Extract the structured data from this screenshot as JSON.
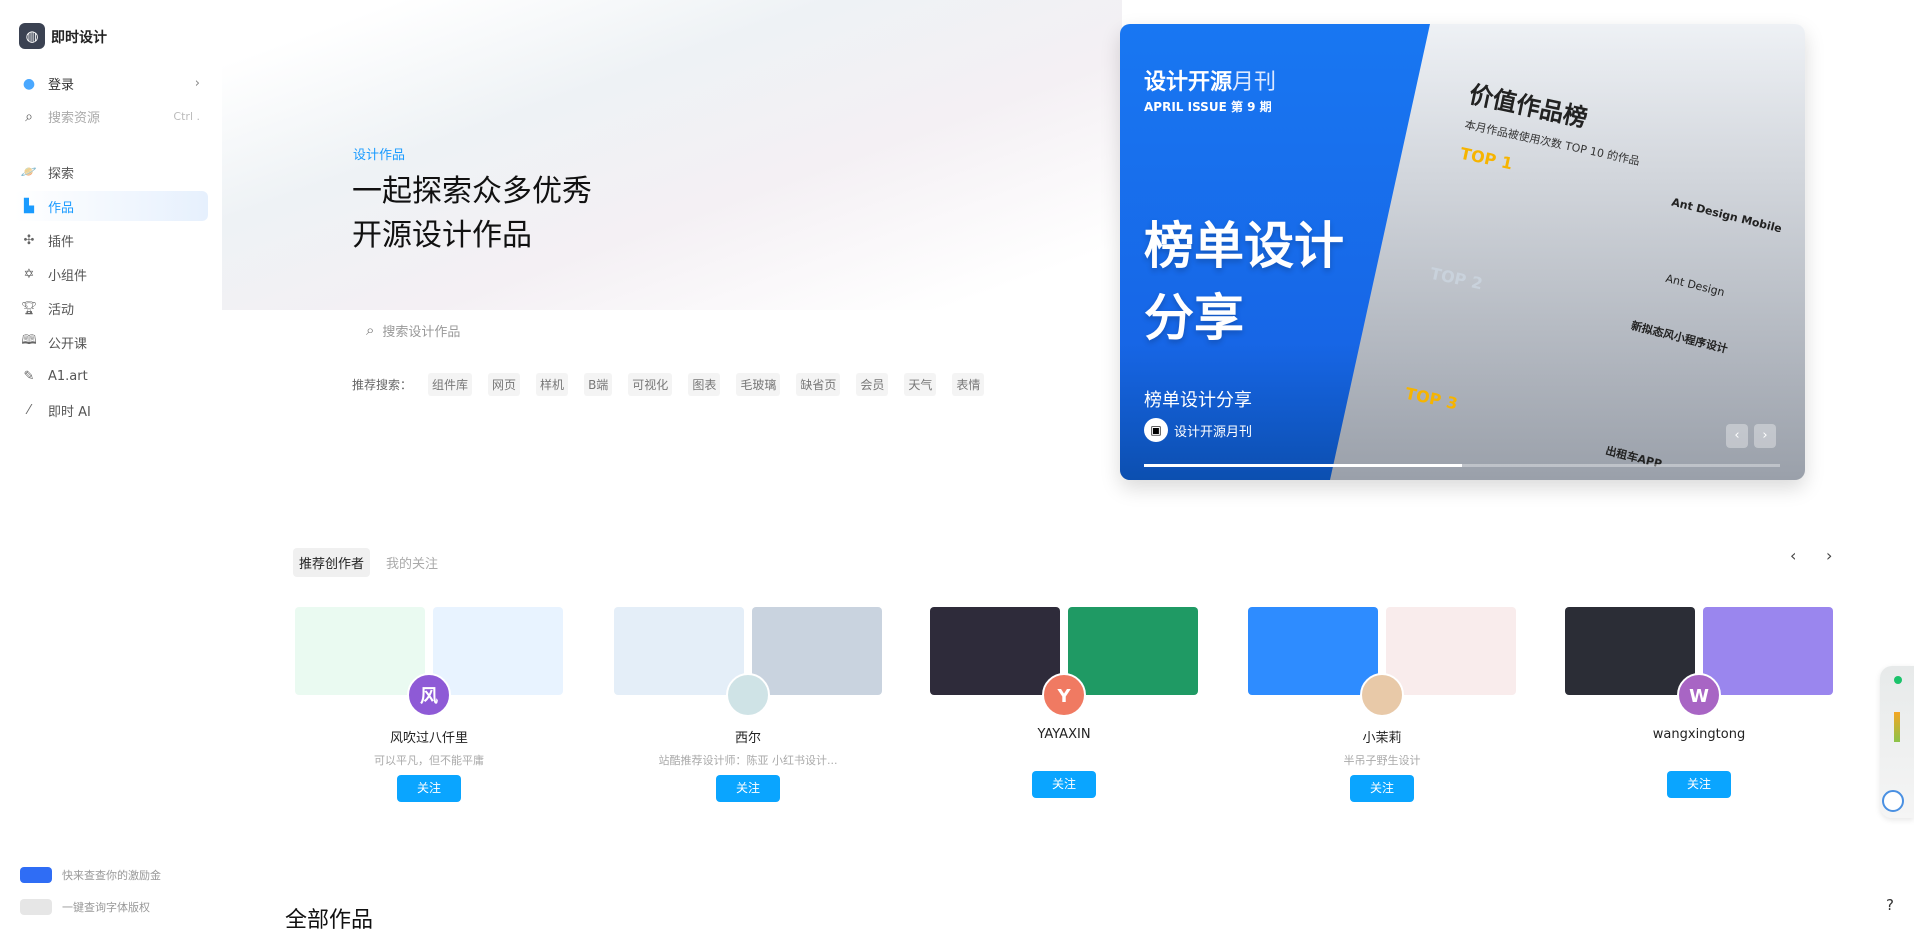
{
  "app": {
    "name": "即时设计",
    "logo_icon": "flame-logo-icon"
  },
  "sidebar": {
    "login": "登录",
    "search": {
      "placeholder": "搜索资源",
      "shortcut": "Ctrl ."
    },
    "items": [
      {
        "label": "探索",
        "icon": "planet-icon"
      },
      {
        "label": "作品",
        "icon": "file-icon",
        "active": true
      },
      {
        "label": "插件",
        "icon": "puzzle-icon"
      },
      {
        "label": "小组件",
        "icon": "widget-icon"
      },
      {
        "label": "活动",
        "icon": "trophy-icon"
      },
      {
        "label": "公开课",
        "icon": "book-icon"
      },
      {
        "label": "A1.art",
        "icon": "brush-icon"
      },
      {
        "label": "即时 AI",
        "icon": "magic-wand-icon"
      }
    ],
    "promos": [
      {
        "label": "快来查查你的激励金"
      },
      {
        "label": "一键查询字体版权"
      }
    ]
  },
  "hero": {
    "label": "设计作品",
    "title_line1": "一起探索众多优秀",
    "title_line2": "开源设计作品",
    "search_placeholder": "搜索设计作品",
    "recommend_label": "推荐搜索：",
    "tags": [
      "组件库",
      "网页",
      "样机",
      "B端",
      "可视化",
      "图表",
      "毛玻璃",
      "缺省页",
      "会员",
      "天气",
      "表情"
    ]
  },
  "banner": {
    "magazine_bold": "设计开源",
    "magazine_light": "月刊",
    "issue": "APRIL ISSUE  第 9 期",
    "headline_1": "榜单设计",
    "headline_2": "分享",
    "subtitle": "榜单设计分享",
    "source": "设计开源月刊",
    "rank_title": "价值作品榜",
    "rank_subtitle": "本月作品被使用次数 TOP 10 的作品",
    "top1": "TOP 1",
    "top2": "TOP 2",
    "top3": "TOP 3",
    "item1": "Ant Design Mobile",
    "item1_brand": "Ant Design",
    "item2": "新拟态风小程序设计",
    "item3": "出租车APP",
    "progress": 0.5,
    "accent": "#1877f2"
  },
  "creators": {
    "tabs": [
      "推荐创作者",
      "我的关注"
    ],
    "follow_label": "关注",
    "list": [
      {
        "name": "风吹过八仟里",
        "desc": "可以平凡，但不能平庸",
        "avatar": "风",
        "avatar_color": "#8e5ad6",
        "img1": "#eafaf1",
        "img2": "#e8f3ff"
      },
      {
        "name": "西尔",
        "desc": "站酷推荐设计师：陈亚 小红书设计...",
        "avatar": "",
        "avatar_color": "#cfe3e6",
        "img1": "#e4eef8",
        "img2": "#c9d3df"
      },
      {
        "name": "YAYAXIN",
        "desc": "",
        "avatar": "Y",
        "avatar_color": "#f07a62",
        "img1": "#2e2b3a",
        "img2": "#1f9a64"
      },
      {
        "name": "小茉莉",
        "desc": "半吊子野生设计",
        "avatar": "",
        "avatar_color": "#e8c9a8",
        "img1": "#2e8cff",
        "img2": "#f9ecec"
      },
      {
        "name": "wangxingtong",
        "desc": "",
        "avatar": "W",
        "avatar_color": "#a865c4",
        "img1": "#2b2d36",
        "img2": "#9a86ee"
      }
    ]
  },
  "section": {
    "all_works": "全部作品"
  },
  "help": "?"
}
